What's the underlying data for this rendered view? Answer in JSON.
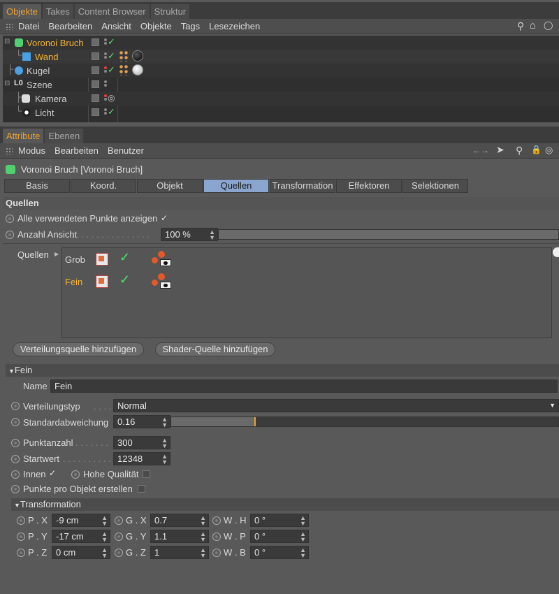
{
  "obj_tabs": [
    "Objekte",
    "Takes",
    "Content Browser",
    "Struktur"
  ],
  "obj_menu": [
    "Datei",
    "Bearbeiten",
    "Ansicht",
    "Objekte",
    "Tags",
    "Lesezeichen"
  ],
  "objects": [
    {
      "name": "Voronoi Bruch",
      "icon": "voronoi-icon"
    },
    {
      "name": "Wand",
      "icon": "cube-icon"
    },
    {
      "name": "Kugel",
      "icon": "sphere-icon"
    },
    {
      "name": "Szene",
      "icon": "null-icon",
      "icon_text": "L0"
    },
    {
      "name": "Kamera",
      "icon": "camera-icon"
    },
    {
      "name": "Licht",
      "icon": "light-icon"
    }
  ],
  "attr_tabs": [
    "Attribute",
    "Ebenen"
  ],
  "attr_menu": [
    "Modus",
    "Bearbeiten",
    "Benutzer"
  ],
  "object_title": "Voronoi Bruch [Voronoi Bruch]",
  "property_tabs": [
    "Basis",
    "Koord.",
    "Objekt",
    "Quellen",
    "Transformation",
    "Effektoren",
    "Selektionen"
  ],
  "active_property_tab": "Quellen",
  "quellen": {
    "section_label": "Quellen",
    "show_unused_points_label": "Alle verwendeten Punkte anzeigen",
    "show_unused_points_checked": true,
    "count_view_label": "Anzahl Ansicht",
    "count_view_value": "100 %",
    "sources_label": "Quellen",
    "sources": [
      {
        "name": "Grob",
        "highlighted": false
      },
      {
        "name": "Fein",
        "highlighted": true
      }
    ],
    "add_distribution_button": "Verteilungsquelle hinzufügen",
    "add_shader_button": "Shader-Quelle hinzufügen"
  },
  "fein": {
    "section_label": "Fein",
    "name_label": "Name",
    "name_value": "Fein",
    "distribution_type_label": "Verteilungstyp",
    "distribution_type_value": "Normal",
    "std_dev_label": "Standardabweichung",
    "std_dev_value": "0.16",
    "std_dev_fraction": 0.16,
    "point_count_label": "Punktanzahl",
    "point_count_value": "300",
    "seed_label": "Startwert",
    "seed_value": "12348",
    "inner_label": "Innen",
    "inner_checked": true,
    "high_quality_label": "Hohe Qualität",
    "high_quality_checked": false,
    "points_per_object_label": "Punkte pro Objekt erstellen",
    "points_per_object_checked": false
  },
  "transformation": {
    "section_label": "Transformation",
    "rows": [
      [
        {
          "label": "P . X",
          "value": "-9 cm"
        },
        {
          "label": "G . X",
          "value": "0.7"
        },
        {
          "label": "W . H",
          "value": "0 °"
        }
      ],
      [
        {
          "label": "P . Y",
          "value": "-17 cm"
        },
        {
          "label": "G . Y",
          "value": "1.1"
        },
        {
          "label": "W . P",
          "value": "0 °"
        }
      ],
      [
        {
          "label": "P . Z",
          "value": "0 cm"
        },
        {
          "label": "G . Z",
          "value": "1"
        },
        {
          "label": "W . B",
          "value": "0 °"
        }
      ]
    ]
  }
}
